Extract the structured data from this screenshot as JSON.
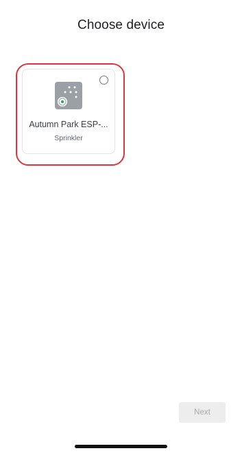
{
  "header": {
    "title": "Choose device"
  },
  "devices": [
    {
      "name": "Autumn Park ESP-...",
      "type": "Sprinkler",
      "icon": "sprinkler-controller-icon",
      "selected": false
    }
  ],
  "footer": {
    "next_label": "Next",
    "next_enabled": false
  },
  "colors": {
    "highlight": "#e0343c",
    "icon_tile": "#9aa0a6",
    "icon_accent": "#34a853"
  }
}
